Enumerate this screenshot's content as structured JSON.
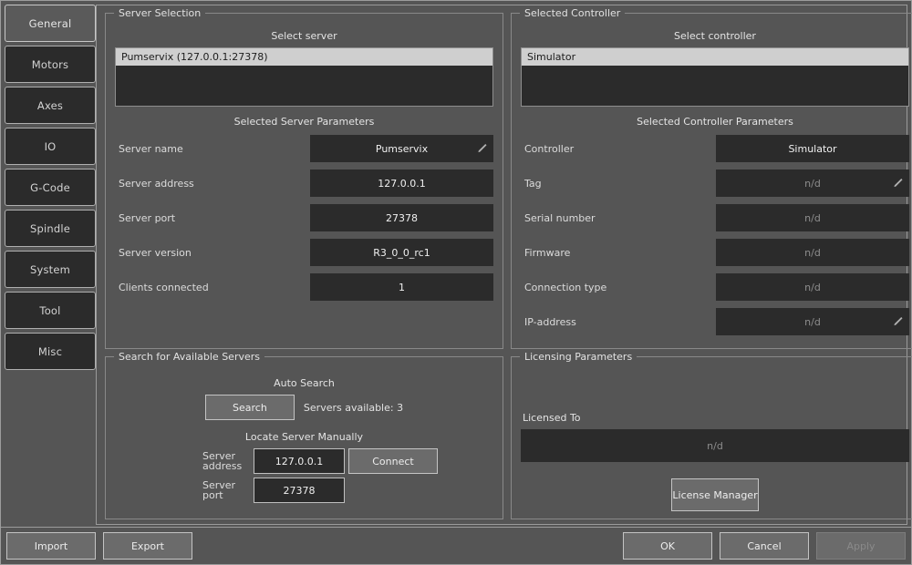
{
  "sidebar": {
    "items": [
      {
        "label": "General",
        "active": true
      },
      {
        "label": "Motors",
        "active": false
      },
      {
        "label": "Axes",
        "active": false
      },
      {
        "label": "IO",
        "active": false
      },
      {
        "label": "G-Code",
        "active": false
      },
      {
        "label": "Spindle",
        "active": false
      },
      {
        "label": "System",
        "active": false
      },
      {
        "label": "Tool",
        "active": false
      },
      {
        "label": "Misc",
        "active": false
      }
    ]
  },
  "server_selection": {
    "group_title": "Server Selection",
    "list_caption": "Select server",
    "servers": [
      {
        "label": "Pumservix (127.0.0.1:27378)",
        "selected": true
      }
    ],
    "params_caption": "Selected Server Parameters",
    "params": [
      {
        "label": "Server name",
        "value": "Pumservix",
        "dim": false,
        "editable": true
      },
      {
        "label": "Server address",
        "value": "127.0.0.1",
        "dim": false,
        "editable": false
      },
      {
        "label": "Server port",
        "value": "27378",
        "dim": false,
        "editable": false
      },
      {
        "label": "Server version",
        "value": "R3_0_0_rc1",
        "dim": false,
        "editable": false
      },
      {
        "label": "Clients connected",
        "value": "1",
        "dim": false,
        "editable": false
      }
    ]
  },
  "controller_selection": {
    "group_title": "Selected Controller",
    "list_caption": "Select controller",
    "controllers": [
      {
        "label": "Simulator",
        "selected": true
      }
    ],
    "params_caption": "Selected Controller Parameters",
    "params": [
      {
        "label": "Controller",
        "value": "Simulator",
        "dim": false,
        "editable": false
      },
      {
        "label": "Tag",
        "value": "n/d",
        "dim": true,
        "editable": true
      },
      {
        "label": "Serial number",
        "value": "n/d",
        "dim": true,
        "editable": false
      },
      {
        "label": "Firmware",
        "value": "n/d",
        "dim": true,
        "editable": false
      },
      {
        "label": "Connection type",
        "value": "n/d",
        "dim": true,
        "editable": false
      },
      {
        "label": "IP-address",
        "value": "n/d",
        "dim": true,
        "editable": true
      }
    ]
  },
  "search": {
    "group_title": "Search for Available Servers",
    "auto_caption": "Auto Search",
    "search_button": "Search",
    "servers_available": "Servers available: 3",
    "manual_caption": "Locate Server Manually",
    "address_label_line1": "Server",
    "address_label_line2": "address",
    "address_value": "127.0.0.1",
    "connect_button": "Connect",
    "port_label_line1": "Server",
    "port_label_line2": "port",
    "port_value": "27378"
  },
  "licensing": {
    "group_title": "Licensing Parameters",
    "licensed_to_label": "Licensed To",
    "licensed_to_value": "n/d",
    "license_manager_button": "License Manager"
  },
  "footer": {
    "import_label": "Import",
    "export_label": "Export",
    "ok_label": "OK",
    "cancel_label": "Cancel",
    "apply_label": "Apply",
    "apply_disabled": true
  },
  "colors": {
    "dialog_bg": "#555555",
    "field_bg": "#2b2b2b",
    "tab_inactive_bg": "#2b2b2b",
    "tab_active_bg": "#5a5a5a",
    "button_bg": "#6b6b6b",
    "selection_bg": "#cfcfcf",
    "border": "#9c9c9c",
    "text": "#dcdcdc",
    "text_dim": "#8d8d8d"
  }
}
